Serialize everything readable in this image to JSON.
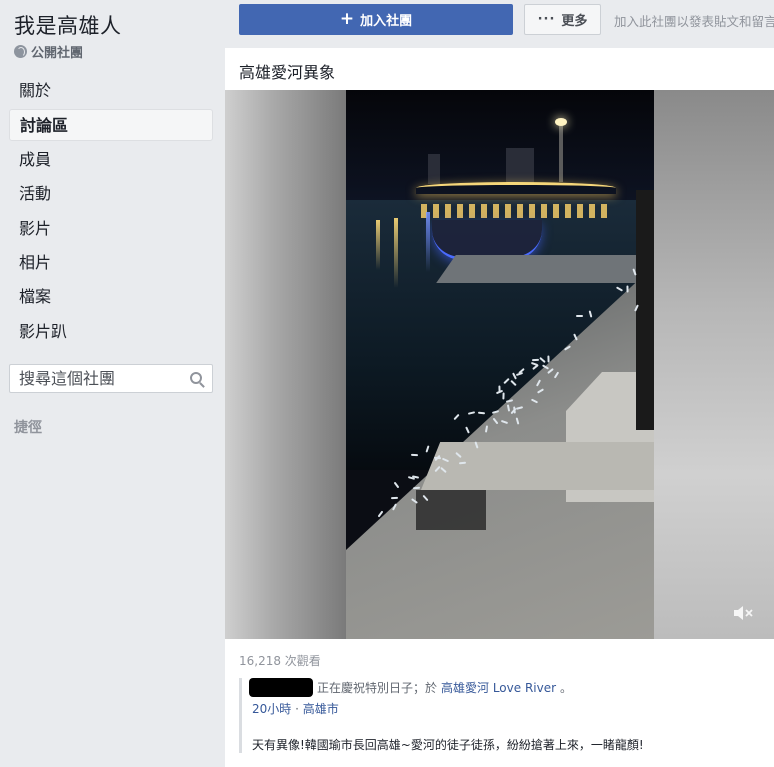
{
  "group": {
    "title": "我是高雄人",
    "type_label": "公開社團"
  },
  "sidebar": {
    "items": [
      {
        "label": "關於"
      },
      {
        "label": "討論區"
      },
      {
        "label": "成員"
      },
      {
        "label": "活動"
      },
      {
        "label": "影片"
      },
      {
        "label": "相片"
      },
      {
        "label": "檔案"
      },
      {
        "label": "影片趴"
      }
    ],
    "active_index": 1,
    "search_placeholder": "搜尋這個社團",
    "shortcuts_label": "捷徑"
  },
  "header": {
    "join_label": "加入社團",
    "more_label": "更多",
    "join_hint": "加入此社團以發表貼文和留言"
  },
  "post": {
    "title": "高雄愛河異象",
    "views": "16,218 次觀看",
    "shared_prefix": "正在慶祝特別日子；於",
    "shared_place": "高雄愛河 Love River",
    "shared_suffix": "。",
    "time": "20小時",
    "separator": "·",
    "location": "高雄市",
    "caption": "天有異像!韓國瑜市長回高雄~愛河的徒子徒孫，紛紛搶著上來，一睹龍顏!"
  },
  "colors": {
    "brand_blue": "#4267b2",
    "link_blue": "#365899",
    "page_bg": "#e9ebee"
  },
  "icons": {
    "globe": "globe-icon",
    "search": "search-icon",
    "plus": "plus-icon",
    "more": "more-dots-icon",
    "mute": "speaker-muted-icon"
  }
}
